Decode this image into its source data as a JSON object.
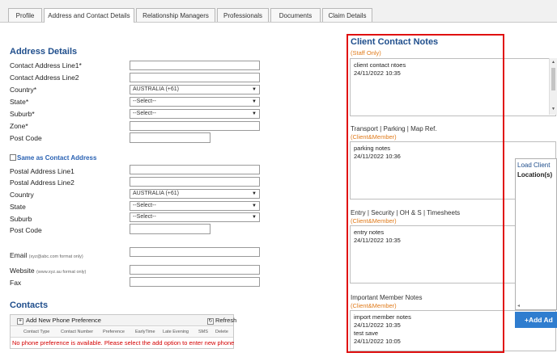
{
  "tabs": [
    "Profile",
    "Address and Contact Details",
    "Relationship Managers",
    "Professionals",
    "Documents",
    "Claim Details"
  ],
  "address": {
    "title": "Address Details",
    "line1": "Contact Address Line1*",
    "line2": "Contact Address Line2",
    "country": "Country*",
    "country_value": "AUSTRALIA (+61)",
    "state": "State*",
    "state_value": "--Select--",
    "suburb": "Suburb*",
    "suburb_value": "--Select--",
    "zone": "Zone*",
    "postcode": "Post Code",
    "same_as": "Same as Contact Address",
    "postal1": "Postal Address Line1",
    "postal2": "Postal Address Line2",
    "postal_country": "Country",
    "postal_country_value": "AUSTRALIA (+61)",
    "postal_state": "State",
    "postal_state_value": "--Select--",
    "postal_suburb": "Suburb",
    "postal_suburb_value": "--Select--",
    "postal_postcode": "Post Code",
    "email": "Email",
    "email_hint": "(xyz@abc.com format only)",
    "website": "Website",
    "website_hint": "(www.xyz.au format only)",
    "fax": "Fax"
  },
  "contacts": {
    "title": "Contacts",
    "add_label": "Add New Phone Preference",
    "refresh_label": "Refresh",
    "columns": [
      "Contact Type",
      "Contact Number",
      "Preference",
      "EarlyTime",
      "Late Evening",
      "SMS",
      "Delete"
    ],
    "empty_message": "No phone preference is available. Please select the add option to enter new phone"
  },
  "notes": {
    "title": "Client Contact Notes",
    "staff_only": "(Staff Only)",
    "client_note": [
      "client contact ntoes",
      "24/11/2022 10:35"
    ],
    "transport_head": "Transport | Parking | Map Ref.",
    "transport_tag": "(Client&Member)",
    "transport_note": [
      "parking notes",
      "24/11/2022 10:36"
    ],
    "entry_head": "Entry | Security | OH & S | Timesheets",
    "entry_tag": "(Client&Member)",
    "entry_note": [
      "entry notes",
      "24/11/2022 10:35"
    ],
    "important_head": "Important Member Notes",
    "important_tag": "(Client&Member)",
    "important_note": [
      "import member notes",
      "24/11/2022 10:35",
      "test save",
      "24/11/2022 10:05"
    ]
  },
  "popup": {
    "title": "Load Client",
    "location": "Location(s)",
    "button": "+Add Ad"
  },
  "colors": {
    "accent": "#1f4e8c",
    "orange": "#e07a1a",
    "highlight": "#e01010",
    "error": "#d40000",
    "button": "#2f7dcf"
  }
}
